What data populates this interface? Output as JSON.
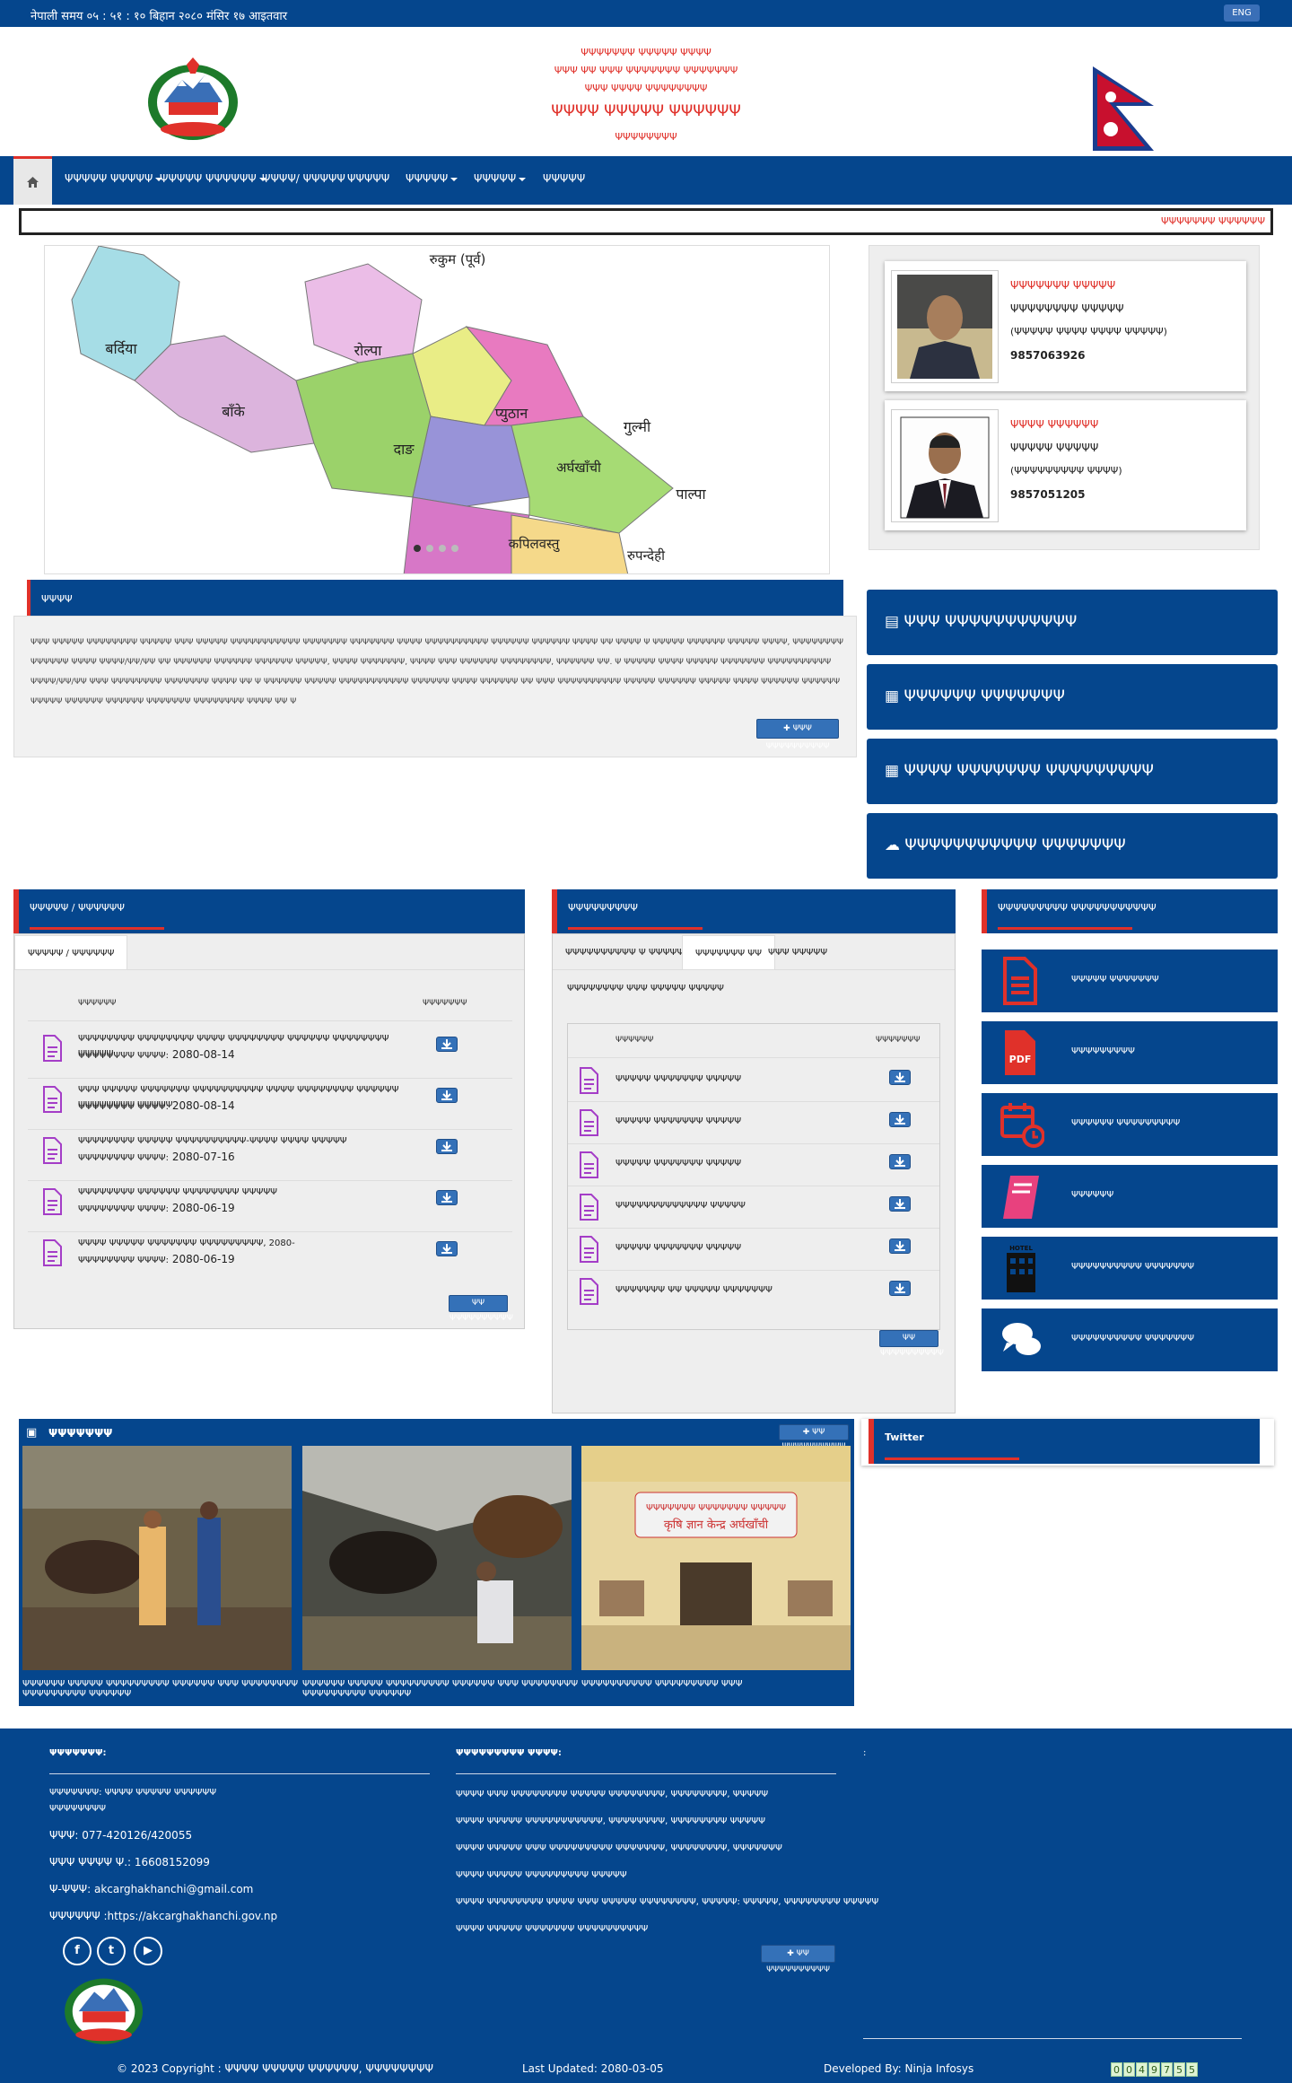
{
  "topbar": {
    "nepali_time": "नेपाली समय ०५ : ५१ : १० बिहान   २०८० मंसिर १७ आइतवार",
    "lang_button": "ENG"
  },
  "header": {
    "line1": "ΨΨΨΨΨΨΨ ΨΨΨΨΨ ΨΨΨΨ",
    "line2": "ΨΨΨ ΨΨ ΨΨΨ ΨΨΨΨΨΨΨ ΨΨΨΨΨΨΨ",
    "line3": "ΨΨΨ ΨΨΨΨ ΨΨΨΨΨΨΨΨ",
    "office_name": "ΨΨΨΨ ΨΨΨΨΨ ΨΨΨΨΨΨ",
    "location": "ΨΨΨΨΨΨΨΨ"
  },
  "nav": {
    "home_icon": "home-icon",
    "items": [
      {
        "label": "ΨΨΨΨΨ ΨΨΨΨΨ",
        "dropdown": true
      },
      {
        "label": "ΨΨΨΨΨ ΨΨΨΨΨΨ",
        "dropdown": true
      },
      {
        "label": "ΨΨΨΨ/ ΨΨΨΨΨ",
        "dropdown": false
      },
      {
        "label": "ΨΨΨΨΨ",
        "dropdown": false
      },
      {
        "label": "ΨΨΨΨΨ",
        "dropdown": true
      },
      {
        "label": "ΨΨΨΨΨ",
        "dropdown": true
      },
      {
        "label": "ΨΨΨΨΨ",
        "dropdown": false
      }
    ]
  },
  "ticker": {
    "text": "ΨΨΨΨΨΨΨ ΨΨΨΨΨΨ"
  },
  "slider": {
    "districts": [
      "रुकुम (पूर्व)",
      "बर्दिया",
      "रोल्पा",
      "बाँके",
      "प्युठान",
      "गुल्मी",
      "दाङ",
      "अर्घखाँची",
      "पाल्पा",
      "कपिलवस्तु",
      "रुपन्देही"
    ],
    "dots": 4,
    "active_dot": 0
  },
  "officials": [
    {
      "role": "ΨΨΨΨΨΨΨ ΨΨΨΨΨ",
      "name": "ΨΨΨΨΨΨΨΨ ΨΨΨΨΨ",
      "designation": "(ΨΨΨΨΨ ΨΨΨΨ ΨΨΨΨ ΨΨΨΨΨ)",
      "phone": "9857063926"
    },
    {
      "role": "ΨΨΨΨ ΨΨΨΨΨΨ",
      "name": "ΨΨΨΨΨ ΨΨΨΨΨ",
      "designation": "(ΨΨΨΨΨΨΨΨΨ ΨΨΨΨ)",
      "phone": "9857051205"
    }
  ],
  "intro": {
    "heading": "ΨΨΨΨ",
    "text": "ΨΨΨ ΨΨΨΨΨ ΨΨΨΨΨΨΨΨ ΨΨΨΨΨ ΨΨΨ ΨΨΨΨΨ ΨΨΨΨΨΨΨΨΨΨΨ ΨΨΨΨΨΨΨ ΨΨΨΨΨΨΨ ΨΨΨΨ ΨΨΨΨΨΨΨΨΨΨ ΨΨΨΨΨΨ ΨΨΨΨΨΨ ΨΨΨΨ ΨΨ ΨΨΨΨ Ψ ΨΨΨΨΨ ΨΨΨΨΨΨ ΨΨΨΨΨ ΨΨΨΨ, ΨΨΨΨΨΨΨΨ ΨΨΨΨΨΨ ΨΨΨΨ ΨΨΨΨ/ΨΨ/ΨΨ ΨΨ ΨΨΨΨΨΨ ΨΨΨΨΨΨ ΨΨΨΨΨΨ ΨΨΨΨΨ, ΨΨΨΨ ΨΨΨΨΨΨΨ, ΨΨΨΨ ΨΨΨ ΨΨΨΨΨΨ ΨΨΨΨΨΨΨΨ, ΨΨΨΨΨΨ ΨΨ. Ψ ΨΨΨΨΨ ΨΨΨΨ ΨΨΨΨΨ ΨΨΨΨΨΨΨ ΨΨΨΨΨΨΨΨΨΨ ΨΨΨΨ/ΨΨ/ΨΨ ΨΨΨ ΨΨΨΨΨΨΨΨ ΨΨΨΨΨΨΨ ΨΨΨΨ ΨΨ Ψ ΨΨΨΨΨΨ ΨΨΨΨΨ ΨΨΨΨΨΨΨΨΨΨΨ ΨΨΨΨΨΨ ΨΨΨΨ ΨΨΨΨΨΨ ΨΨ ΨΨΨ ΨΨΨΨΨΨΨΨΨΨ ΨΨΨΨΨ ΨΨΨΨΨΨ ΨΨΨΨΨ ΨΨΨΨ ΨΨΨΨΨΨ ΨΨΨΨΨΨ ΨΨΨΨΨ ΨΨΨΨΨΨ ΨΨΨΨΨΨ ΨΨΨΨΨΨΨ ΨΨΨΨΨΨΨΨ ΨΨΨΨ ΨΨ Ψ",
    "more_button": "ΨΨΨ ΨΨΨΨΨΨΨΨΨΨ"
  },
  "link_buttons": [
    {
      "icon": "file-icon",
      "label": "ΨΨΨ ΨΨΨΨΨΨΨΨΨΨΨ"
    },
    {
      "icon": "newspaper-icon",
      "label": "ΨΨΨΨΨΨ ΨΨΨΨΨΨΨ"
    },
    {
      "icon": "newspaper-icon",
      "label": "ΨΨΨΨ ΨΨΨΨΨΨΨ ΨΨΨΨΨΨΨΨΨ"
    },
    {
      "icon": "comments-icon",
      "label": "ΨΨΨΨΨΨΨΨΨΨΨ ΨΨΨΨΨΨΨ"
    }
  ],
  "news_panel": {
    "heading": "ΨΨΨΨΨ / ΨΨΨΨΨΨ",
    "tab": "ΨΨΨΨΨ / ΨΨΨΨΨΨ",
    "col_title": "ΨΨΨΨΨΨ",
    "col_download": "ΨΨΨΨΨΨΨ",
    "rows": [
      {
        "title": "ΨΨΨΨΨΨΨΨ ΨΨΨΨΨΨΨΨ ΨΨΨΨ ΨΨΨΨΨΨΨΨ ΨΨΨΨΨΨ ΨΨΨΨΨΨΨΨ ΨΨΨΨΨ",
        "date_label": "ΨΨΨΨΨΨΨΨ ΨΨΨΨ:",
        "date": "2080-08-14"
      },
      {
        "title": "ΨΨΨ ΨΨΨΨΨ ΨΨΨΨΨΨΨ ΨΨΨΨΨΨΨΨΨΨ ΨΨΨΨ ΨΨΨΨΨΨΨΨ ΨΨΨΨΨΨ ΨΨΨΨΨΨΨΨ ΨΨΨΨΨ",
        "date_label": "ΨΨΨΨΨΨΨΨ ΨΨΨΨ:",
        "date": "2080-08-14"
      },
      {
        "title": "ΨΨΨΨΨΨΨΨ ΨΨΨΨΨ ΨΨΨΨΨΨΨΨΨΨ-ΨΨΨΨ ΨΨΨΨ ΨΨΨΨΨ",
        "date_label": "ΨΨΨΨΨΨΨΨ ΨΨΨΨ:",
        "date": "2080-07-16"
      },
      {
        "title": "ΨΨΨΨΨΨΨΨ ΨΨΨΨΨΨ ΨΨΨΨΨΨΨΨ ΨΨΨΨΨ",
        "date_label": "ΨΨΨΨΨΨΨΨ ΨΨΨΨ:",
        "date": "2080-06-19"
      },
      {
        "title": "ΨΨΨΨ ΨΨΨΨΨ ΨΨΨΨΨΨΨ ΨΨΨΨΨΨΨΨΨ, 2080-",
        "date_label": "ΨΨΨΨΨΨΨΨ ΨΨΨΨ:",
        "date": "2080-06-19"
      }
    ],
    "all_button": "ΨΨ ΨΨΨΨΨΨΨΨΨΨ"
  },
  "docs_panel": {
    "heading": "ΨΨΨΨΨΨΨΨΨ",
    "tabs": [
      "ΨΨΨΨΨΨΨΨΨΨ Ψ ΨΨΨΨΨΨΨΨΨ",
      "ΨΨΨΨΨΨΨ ΨΨ",
      "ΨΨΨ ΨΨΨΨΨ"
    ],
    "active_tab": 1,
    "subtitle": "ΨΨΨΨΨΨΨΨ ΨΨΨ ΨΨΨΨΨ ΨΨΨΨΨ",
    "col_title": "ΨΨΨΨΨΨ",
    "col_download": "ΨΨΨΨΨΨΨ",
    "rows": [
      "ΨΨΨΨΨ ΨΨΨΨΨΨΨ ΨΨΨΨΨ",
      "ΨΨΨΨΨ ΨΨΨΨΨΨΨ ΨΨΨΨΨ",
      "ΨΨΨΨΨ ΨΨΨΨΨΨΨ ΨΨΨΨΨ",
      "ΨΨΨΨΨΨΨΨΨΨΨΨΨ ΨΨΨΨΨ",
      "ΨΨΨΨΨ ΨΨΨΨΨΨΨ ΨΨΨΨΨ",
      "ΨΨΨΨΨΨΨ ΨΨ ΨΨΨΨΨ ΨΨΨΨΨΨΨ"
    ],
    "all_button": "ΨΨ ΨΨΨΨΨΨΨΨΨΨ"
  },
  "services_panel": {
    "heading": "ΨΨΨΨΨΨΨΨΨ ΨΨΨΨΨΨΨΨΨΨΨ",
    "items": [
      {
        "icon": "document-icon",
        "label": "ΨΨΨΨΨ ΨΨΨΨΨΨΨ"
      },
      {
        "icon": "pdf-icon",
        "label": "ΨΨΨΨΨΨΨΨΨ",
        "icon_text": "PDF"
      },
      {
        "icon": "calendar-clock-icon",
        "label": "ΨΨΨΨΨΨ ΨΨΨΨΨΨΨΨΨ"
      },
      {
        "icon": "book-icon",
        "label": "ΨΨΨΨΨΨ"
      },
      {
        "icon": "hotel-icon",
        "label": "ΨΨΨΨΨΨΨΨΨΨ ΨΨΨΨΨΨΨ",
        "icon_text": "HOTEL"
      },
      {
        "icon": "chat-icon",
        "label": "ΨΨΨΨΨΨΨΨΨΨ ΨΨΨΨΨΨΨ"
      }
    ]
  },
  "gallery": {
    "title": "ΨΨΨΨΨΨΨ",
    "more_button": "ΨΨ ΨΨΨΨΨΨΨΨΨΨ",
    "items": [
      {
        "caption": "ΨΨΨΨΨΨ ΨΨΨΨΨ ΨΨΨΨΨΨΨΨΨ ΨΨΨΨΨΨ ΨΨΨ ΨΨΨΨΨΨΨΨ ΨΨΨΨΨΨΨΨΨ ΨΨΨΨΨΨ"
      },
      {
        "caption": "ΨΨΨΨΨΨ ΨΨΨΨΨ ΨΨΨΨΨΨΨΨΨ ΨΨΨΨΨΨ ΨΨΨ ΨΨΨΨΨΨΨΨ ΨΨΨΨΨΨΨΨΨ ΨΨΨΨΨΨ"
      },
      {
        "caption": "ΨΨΨΨΨΨΨΨΨΨ ΨΨΨΨΨΨΨΨΨ ΨΨΨ",
        "sign_line1": "ΨΨΨΨΨΨΨ ΨΨΨΨΨΨΨ ΨΨΨΨΨ",
        "sign_line2": "कृषि ज्ञान केन्द्र अर्घखाँची"
      }
    ]
  },
  "twitter": {
    "title": "Twitter"
  },
  "footer": {
    "contact_heading": "ΨΨΨΨΨΨΨ:",
    "office": "ΨΨΨΨΨΨΨ: ΨΨΨΨ ΨΨΨΨΨ ΨΨΨΨΨΨ",
    "office2": "ΨΨΨΨΨΨΨΨ",
    "phone": "ΨΨΨ: 077-420126/420055",
    "toll": "ΨΨΨ ΨΨΨΨ Ψ.: 16608152099",
    "email": "Ψ-ΨΨΨ: akcarghakhanchi@gmail.com",
    "website": "ΨΨΨΨΨΨ :https://akcarghakhanchi.gov.np",
    "links_heading": "ΨΨΨΨΨΨΨΨΨ ΨΨΨΨ:",
    "links": [
      "ΨΨΨΨ ΨΨΨ ΨΨΨΨΨΨΨΨ ΨΨΨΨΨ ΨΨΨΨΨΨΨΨ, ΨΨΨΨΨΨΨΨ, ΨΨΨΨΨ",
      "ΨΨΨΨ ΨΨΨΨΨ ΨΨΨΨΨΨΨΨΨΨΨ, ΨΨΨΨΨΨΨΨ, ΨΨΨΨΨΨΨΨ ΨΨΨΨΨ",
      "ΨΨΨΨ ΨΨΨΨΨ ΨΨΨ ΨΨΨΨΨΨΨΨΨ ΨΨΨΨΨΨΨ, ΨΨΨΨΨΨΨΨ, ΨΨΨΨΨΨΨ",
      "ΨΨΨΨ ΨΨΨΨΨ ΨΨΨΨΨΨΨΨΨ ΨΨΨΨΨ",
      "ΨΨΨΨ ΨΨΨΨΨΨΨΨ ΨΨΨΨ ΨΨΨ ΨΨΨΨΨ ΨΨΨΨΨΨΨΨ, ΨΨΨΨΨ: ΨΨΨΨΨ, ΨΨΨΨΨΨΨΨ ΨΨΨΨΨ",
      "ΨΨΨΨ ΨΨΨΨΨ ΨΨΨΨΨΨΨ ΨΨΨΨΨΨΨΨΨΨ"
    ],
    "links_more": "ΨΨ ΨΨΨΨΨΨΨΨΨΨ",
    "third_heading": ":",
    "social": [
      "facebook-icon",
      "twitter-icon",
      "youtube-icon"
    ],
    "copyright": "© 2023 Copyright : ΨΨΨΨ ΨΨΨΨΨ ΨΨΨΨΨΨ, ΨΨΨΨΨΨΨΨ",
    "last_updated": "Last Updated: 2080-03-05",
    "developed_by": "Developed By: Ninja Infosys",
    "counter": "0049755"
  }
}
